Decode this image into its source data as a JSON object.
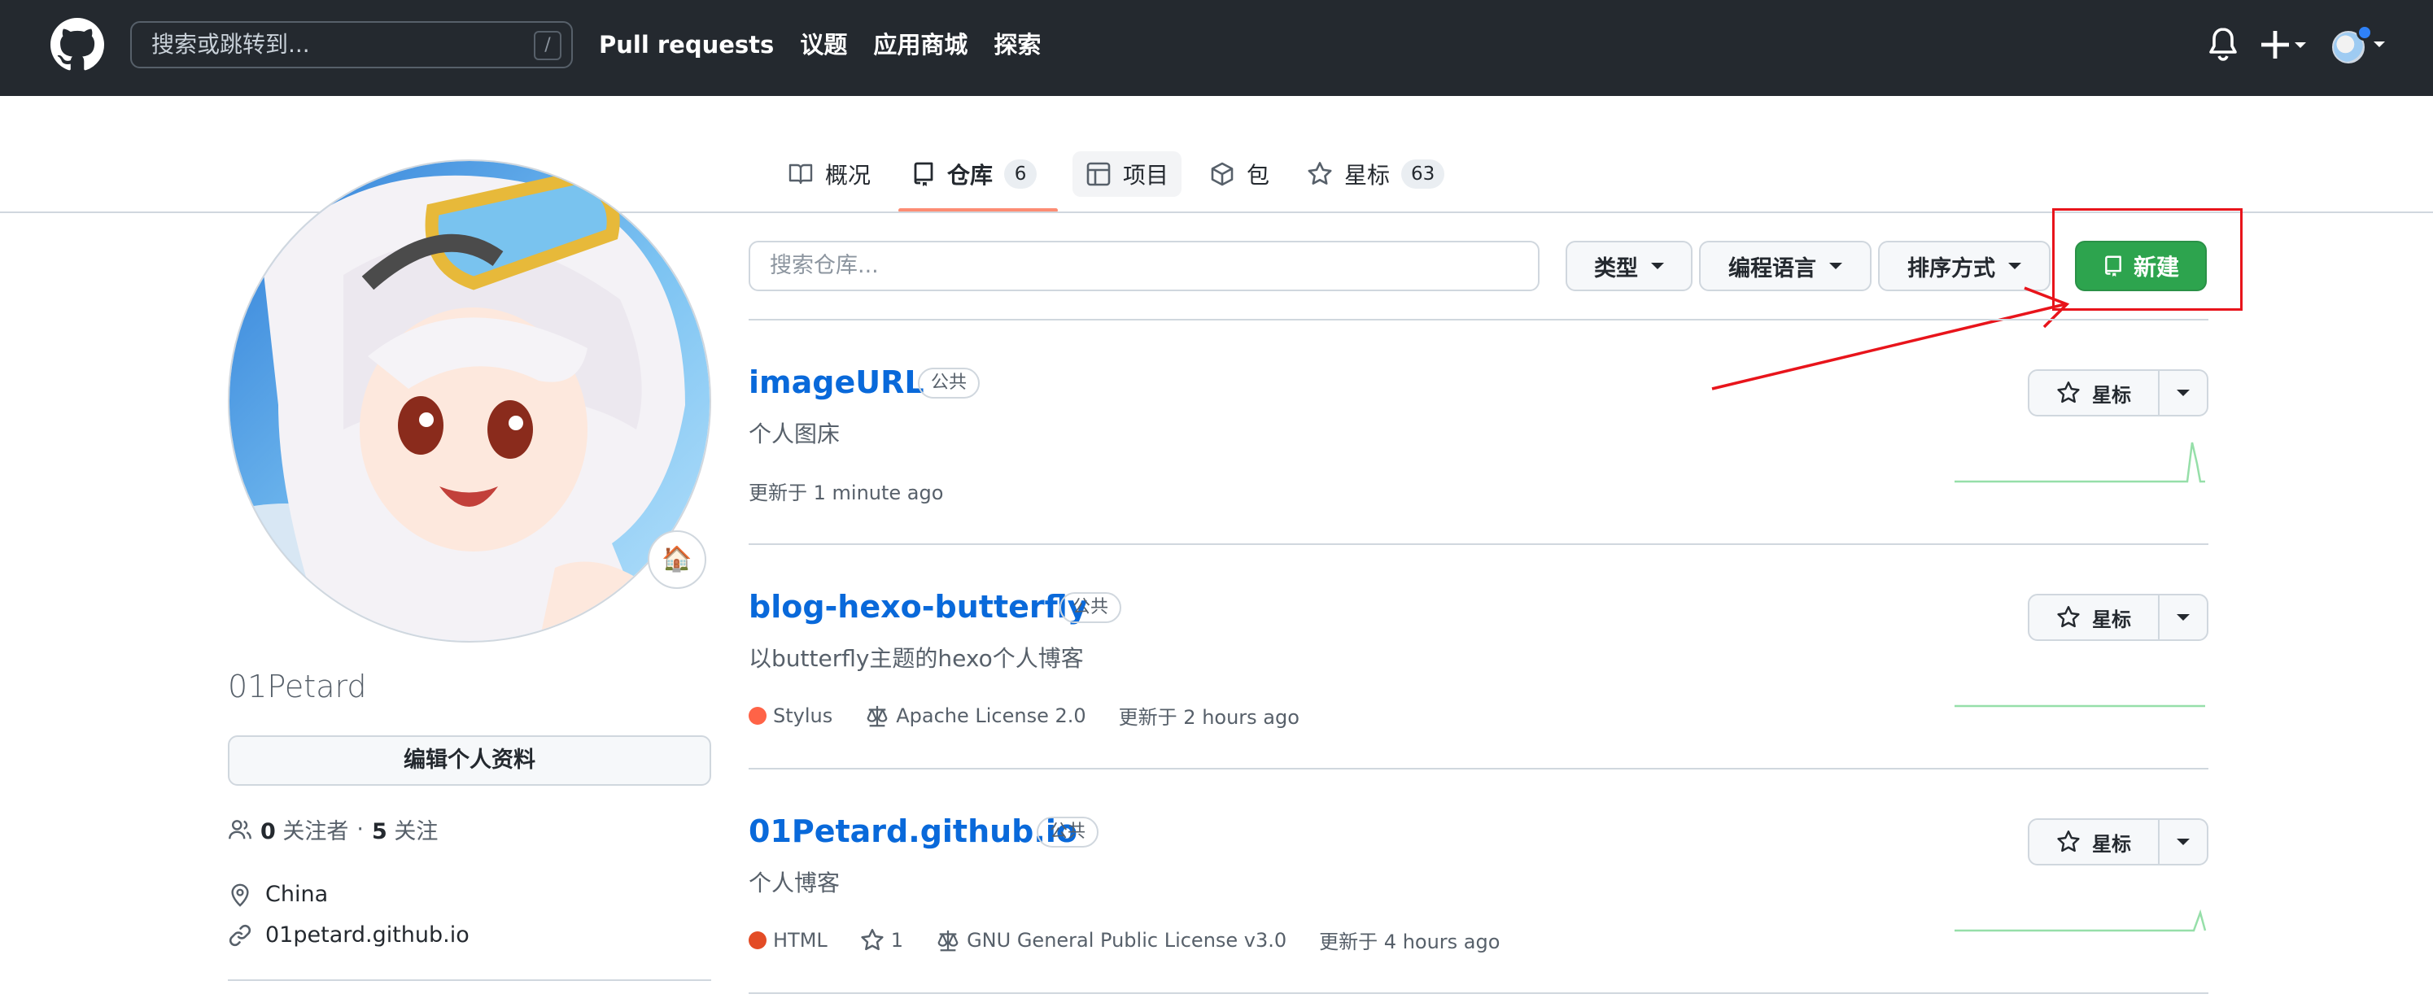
{
  "header": {
    "search_placeholder": "搜索或跳转到...",
    "search_shortcut": "/",
    "nav": [
      "Pull requests",
      "议题",
      "应用商城",
      "探索"
    ],
    "icons": [
      "github-logo-icon",
      "bell-icon",
      "plus-icon",
      "avatar"
    ]
  },
  "tabs": [
    {
      "label": "概况",
      "icon": "book-icon"
    },
    {
      "label": "仓库",
      "icon": "repo-icon",
      "count": "6"
    },
    {
      "label": "项目",
      "icon": "table-icon"
    },
    {
      "label": "包",
      "icon": "package-icon"
    },
    {
      "label": "星标",
      "icon": "star-icon",
      "count": "63"
    }
  ],
  "profile": {
    "username": "01Petard",
    "status_emoji": "🏠",
    "edit_button": "编辑个人资料",
    "followers_count": "0",
    "followers_label": "关注者",
    "following_count": "5",
    "following_label": "关注",
    "location": "China",
    "website": "01petard.github.io"
  },
  "filters": {
    "search_placeholder": "搜索仓库...",
    "type": "类型",
    "language": "编程语言",
    "sort": "排序方式",
    "new_button": "新建"
  },
  "repos": [
    {
      "name": "imageURL",
      "visibility": "公共",
      "description": "个人图床",
      "updated": "更新于 1 minute ago",
      "star_label": "星标"
    },
    {
      "name": "blog-hexo-butterfly",
      "visibility": "公共",
      "description": "以butterfly主题的hexo个人博客",
      "language": "Stylus",
      "language_color": "#ff6347",
      "license": "Apache License 2.0",
      "updated": "更新于 2 hours ago",
      "star_label": "星标"
    },
    {
      "name": "01Petard.github.io",
      "visibility": "公共",
      "description": "个人博客",
      "language": "HTML",
      "language_color": "#e34c26",
      "stars": "1",
      "license": "GNU General Public License v3.0",
      "updated": "更新于 4 hours ago",
      "star_label": "星标"
    }
  ],
  "colors": {
    "header_bg": "#24292f",
    "link": "#0969da",
    "primary_button": "#2da44e",
    "annotation": "#e8141b",
    "tab_underline": "#fd8c73"
  }
}
